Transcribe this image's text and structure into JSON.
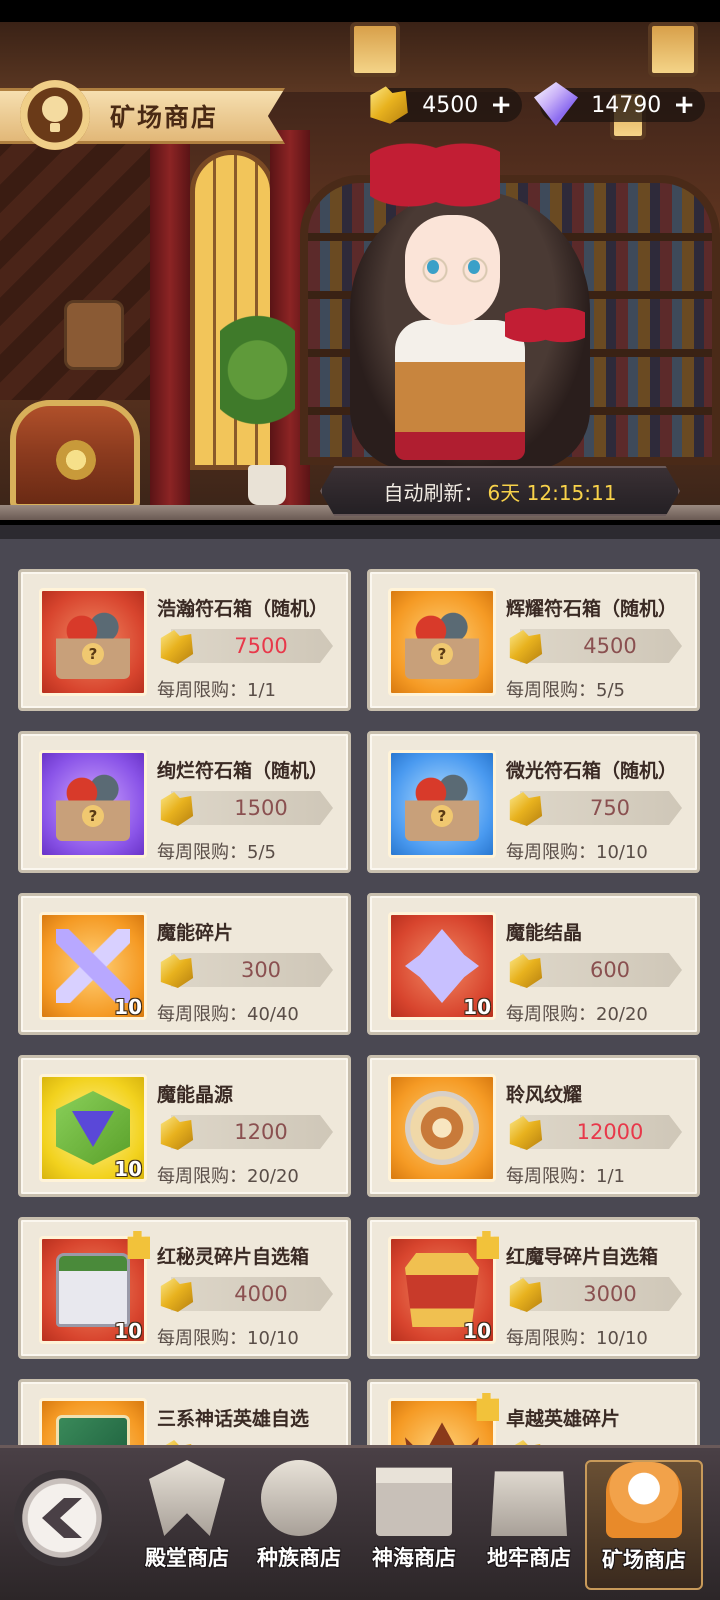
{
  "header": {
    "shop_title": "矿场商店",
    "gold_amount": "4500",
    "gem_amount": "14790",
    "plus_symbol": "+"
  },
  "refresh": {
    "label": "自动刷新：",
    "time": "6天 12:15:11"
  },
  "items": [
    {
      "name": "浩瀚符石箱（随机）",
      "price": "7500",
      "limit": "每周限购：1/1",
      "color": "red",
      "art": "chest",
      "qty": "",
      "price_hot": true
    },
    {
      "name": "辉耀符石箱（随机）",
      "price": "4500",
      "limit": "每周限购：5/5",
      "color": "orange",
      "art": "chest",
      "qty": "",
      "price_hot": false
    },
    {
      "name": "绚烂符石箱（随机）",
      "price": "1500",
      "limit": "每周限购：5/5",
      "color": "purple",
      "art": "chest",
      "qty": "",
      "price_hot": false
    },
    {
      "name": "微光符石箱（随机）",
      "price": "750",
      "limit": "每周限购：10/10",
      "color": "blue",
      "art": "chest",
      "qty": "",
      "price_hot": false
    },
    {
      "name": "魔能碎片",
      "price": "300",
      "limit": "每周限购：40/40",
      "color": "orange",
      "art": "shard",
      "qty": "10",
      "price_hot": false
    },
    {
      "name": "魔能结晶",
      "price": "600",
      "limit": "每周限购：20/20",
      "color": "red",
      "art": "crystal",
      "qty": "10",
      "price_hot": false
    },
    {
      "name": "魔能晶源",
      "price": "1200",
      "limit": "每周限购：20/20",
      "color": "yellow",
      "art": "source",
      "qty": "10",
      "price_hot": false
    },
    {
      "name": "聆风纹耀",
      "price": "12000",
      "limit": "每周限购：1/1",
      "color": "orange",
      "art": "emblem",
      "qty": "",
      "price_hot": true
    },
    {
      "name": "红秘灵碎片自选箱",
      "price": "4000",
      "limit": "每周限购：10/10",
      "color": "red",
      "art": "box-red",
      "qty": "10",
      "price_hot": false
    },
    {
      "name": "红魔导碎片自选箱",
      "price": "3000",
      "limit": "每周限购：10/10",
      "color": "red",
      "art": "box-gold",
      "qty": "10",
      "price_hot": false
    },
    {
      "name": "三系神话英雄自选",
      "price": "",
      "limit": "",
      "color": "orange",
      "art": "card",
      "qty": "",
      "price_hot": false
    },
    {
      "name": "卓越英雄碎片",
      "price": "",
      "limit": "",
      "color": "orange",
      "art": "crown",
      "qty": "",
      "price_hot": false
    }
  ],
  "nav": [
    {
      "label": "殿堂商店",
      "icon": "hall-icon"
    },
    {
      "label": "种族商店",
      "icon": "race-icon"
    },
    {
      "label": "神海商店",
      "icon": "sea-icon"
    },
    {
      "label": "地牢商店",
      "icon": "dungeon-icon"
    },
    {
      "label": "矿场商店",
      "icon": "mine-icon",
      "active": true
    }
  ]
}
